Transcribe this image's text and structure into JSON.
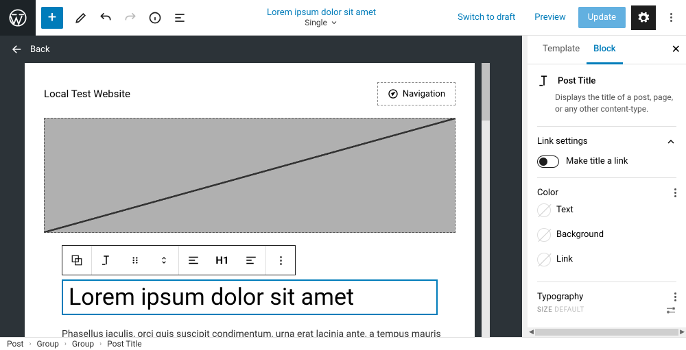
{
  "top": {
    "doc_title": "Lorem ipsum dolor sit amet",
    "doc_sub": "Single",
    "switch_draft": "Switch to draft",
    "preview": "Preview",
    "update": "Update"
  },
  "back": {
    "label": "Back"
  },
  "canvas": {
    "site_title": "Local Test Website",
    "navigation": "Navigation",
    "heading_level": "H1",
    "post_title": "Lorem ipsum dolor sit amet",
    "body": "Phasellus iaculis, orci quis suscipit condimentum, urna erat lacinia ante, a tempus mauris"
  },
  "sidebar": {
    "tabs": {
      "template": "Template",
      "block": "Block"
    },
    "block_name": "Post Title",
    "block_desc": "Displays the title of a post, page, or any other content-type.",
    "link_settings": "Link settings",
    "make_link": "Make title a link",
    "color": "Color",
    "color_text": "Text",
    "color_bg": "Background",
    "color_link": "Link",
    "typography": "Typography",
    "size_label": "SIZE",
    "size_default": "DEFAULT"
  },
  "breadcrumb": [
    "Post",
    "Group",
    "Group",
    "Post Title"
  ]
}
